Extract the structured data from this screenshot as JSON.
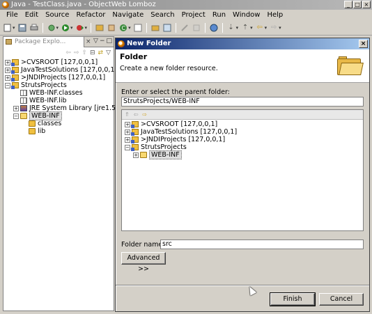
{
  "window": {
    "title": "Java - TestClass.java - ObjectWeb Lomboz",
    "controls": {
      "minimize": "_",
      "maximize": "□",
      "close": "×"
    }
  },
  "menu": [
    "File",
    "Edit",
    "Source",
    "Refactor",
    "Navigate",
    "Search",
    "Project",
    "Run",
    "Window",
    "Help"
  ],
  "package_explorer": {
    "tab_label": "Package Explo...",
    "tab_close": "×",
    "view_menu": "▽",
    "minimize": "−",
    "maximize": "□",
    "tree": [
      {
        "label": ">CVSROOT   [127,0,0,1]",
        "level": 0,
        "expander": "+",
        "icon": "project"
      },
      {
        "label": "JavaTestSolutions   [127,0,0,1]",
        "level": 0,
        "expander": "+",
        "icon": "project"
      },
      {
        "label": ">JNDIProjects   [127,0,0,1]",
        "level": 0,
        "expander": "+",
        "icon": "project"
      },
      {
        "label": "StrutsProjects",
        "level": 0,
        "expander": "−",
        "icon": "project"
      },
      {
        "label": "WEB-INF.classes",
        "level": 1,
        "expander": "",
        "icon": "package"
      },
      {
        "label": "WEB-INF.lib",
        "level": 1,
        "expander": "",
        "icon": "package"
      },
      {
        "label": "JRE System Library [jre1.5.0...",
        "level": 1,
        "expander": "+",
        "icon": "jre"
      },
      {
        "label": "WEB-INF",
        "level": 1,
        "expander": "−",
        "icon": "folder-open",
        "selected": true
      },
      {
        "label": "classes",
        "level": 2,
        "expander": "",
        "icon": "folder"
      },
      {
        "label": "lib",
        "level": 2,
        "expander": "",
        "icon": "folder"
      }
    ]
  },
  "dialog": {
    "title": "New Folder",
    "close": "×",
    "header_title": "Folder",
    "header_desc": "Create a new folder resource.",
    "parent_label": "Enter or select the parent folder:",
    "parent_value": "StrutsProjects/WEB-INF",
    "tree": [
      {
        "label": ">CVSROOT   [127,0,0,1]",
        "level": 0,
        "expander": "+",
        "icon": "project"
      },
      {
        "label": "JavaTestSolutions   [127,0,0,1]",
        "level": 0,
        "expander": "+",
        "icon": "project"
      },
      {
        "label": ">JNDIProjects   [127,0,0,1]",
        "level": 0,
        "expander": "+",
        "icon": "project"
      },
      {
        "label": "StrutsProjects",
        "level": 0,
        "expander": "−",
        "icon": "project"
      },
      {
        "label": "WEB-INF",
        "level": 1,
        "expander": "+",
        "icon": "folder-open",
        "selected": true
      }
    ],
    "folder_name_label": "Folder name:",
    "folder_name_value": "src",
    "advanced_label": "Advanced >>",
    "finish_label": "Finish",
    "cancel_label": "Cancel"
  },
  "colors": {
    "dialog_title_start": "#0a246a",
    "dialog_title_end": "#a6caf0",
    "chrome": "#d4d0c8"
  }
}
